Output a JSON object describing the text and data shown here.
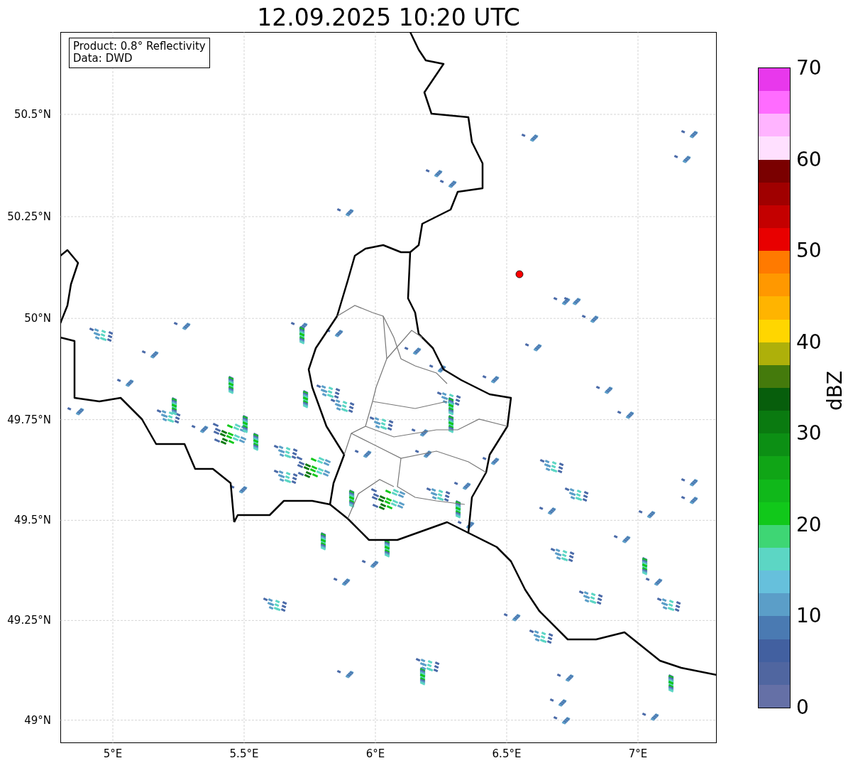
{
  "title": "12.09.2025 10:20 UTC",
  "info_box": [
    "Product: 0.8° Reflectivity",
    "Data: DWD"
  ],
  "x_ticks": [
    "5°E",
    "5.5°E",
    "6°E",
    "6.5°E",
    "7°E"
  ],
  "y_ticks": [
    "50.5°N",
    "50.25°N",
    "50°N",
    "49.75°N",
    "49.5°N",
    "49.25°N",
    "49°N"
  ],
  "colorbar": {
    "label": "dBZ",
    "tick_labels": [
      "70",
      "60",
      "50",
      "40",
      "30",
      "20",
      "10",
      "0"
    ],
    "bins": [
      {
        "color": "#e838ec"
      },
      {
        "color": "#ff6cff"
      },
      {
        "color": "#ffb4ff"
      },
      {
        "color": "#ffe0ff"
      },
      {
        "color": "#7a0000"
      },
      {
        "color": "#a00000"
      },
      {
        "color": "#c40000"
      },
      {
        "color": "#e80000"
      },
      {
        "color": "#ff7a00"
      },
      {
        "color": "#ff9800"
      },
      {
        "color": "#ffb400"
      },
      {
        "color": "#ffd600"
      },
      {
        "color": "#aeb00a"
      },
      {
        "color": "#447a0c"
      },
      {
        "color": "#075e0c"
      },
      {
        "color": "#0a7a10"
      },
      {
        "color": "#0c8f14"
      },
      {
        "color": "#10a516"
      },
      {
        "color": "#10b81a"
      },
      {
        "color": "#11c81a"
      },
      {
        "color": "#3ed674"
      },
      {
        "color": "#5cd6c4"
      },
      {
        "color": "#66c0dc"
      },
      {
        "color": "#5b9ec8"
      },
      {
        "color": "#4a7ab2"
      },
      {
        "color": "#4260a0"
      },
      {
        "color": "#5066a0"
      },
      {
        "color": "#6570a6"
      }
    ]
  }
}
